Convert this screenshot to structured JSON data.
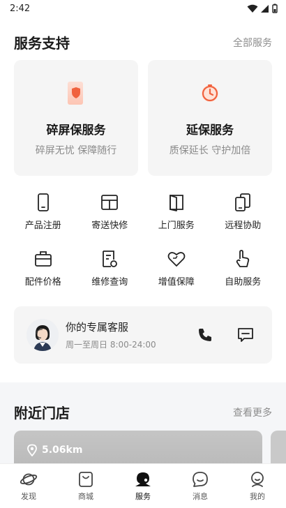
{
  "status": {
    "time": "2:42"
  },
  "support": {
    "title": "服务支持",
    "more": "全部服务",
    "cards": [
      {
        "icon": "shield-phone-icon",
        "title": "碎屏保服务",
        "subtitle": "碎屏无忧 保障随行",
        "accent": "#f0623e"
      },
      {
        "icon": "clock-icon",
        "title": "延保服务",
        "subtitle": "质保延长 守护加倍",
        "accent": "#f0623e"
      }
    ],
    "grid": [
      {
        "icon": "phone-icon",
        "label": "产品注册"
      },
      {
        "icon": "package-icon",
        "label": "寄送快修"
      },
      {
        "icon": "door-icon",
        "label": "上门服务"
      },
      {
        "icon": "remote-devices-icon",
        "label": "远程协助"
      },
      {
        "icon": "briefcase-icon",
        "label": "配件价格"
      },
      {
        "icon": "repair-doc-icon",
        "label": "维修查询"
      },
      {
        "icon": "heart-icon",
        "label": "增值保障"
      },
      {
        "icon": "hand-pointer-icon",
        "label": "自助服务"
      }
    ]
  },
  "agent": {
    "title": "你的专属客服",
    "hours": "周一至周日 8:00-24:00"
  },
  "stores": {
    "title": "附近门店",
    "more": "查看更多",
    "distance": "5.06km"
  },
  "tabs": [
    {
      "icon": "planet-icon",
      "label": "发现",
      "active": false
    },
    {
      "icon": "bag-icon",
      "label": "商城",
      "active": false
    },
    {
      "icon": "service-icon",
      "label": "服务",
      "active": true
    },
    {
      "icon": "chat-icon",
      "label": "消息",
      "active": false
    },
    {
      "icon": "person-icon",
      "label": "我的",
      "active": false
    }
  ]
}
